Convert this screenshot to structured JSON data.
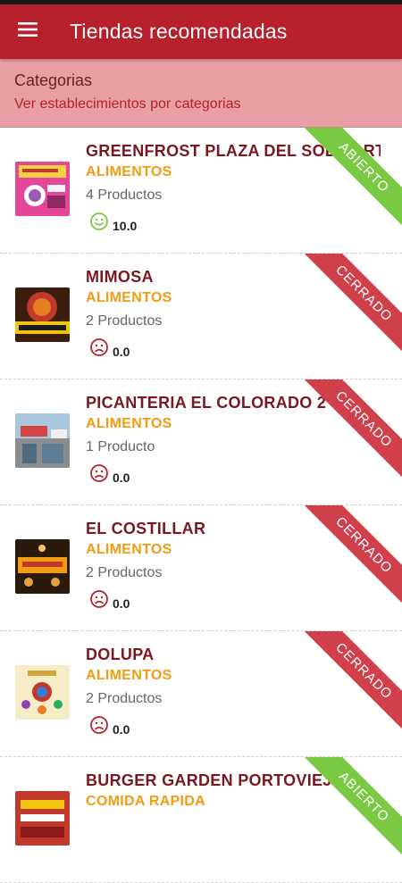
{
  "app": {
    "title": "Tiendas recomendadas",
    "menu_icon": "hamburger-menu-icon"
  },
  "categories": {
    "title": "Categorias",
    "link": "Ver establecimientos por categorias"
  },
  "stores": [
    {
      "name": "GREENFROST PLAZA DEL SOL PORTOVI",
      "category": "ALIMENTOS",
      "products": "4 Productos",
      "rating": "10.0",
      "rating_icon": "happy-face-icon",
      "status": "ABIERTO"
    },
    {
      "name": "MIMOSA",
      "category": "ALIMENTOS",
      "products": "2 Productos",
      "rating": "0.0",
      "rating_icon": "sad-face-icon",
      "status": "CERRADO"
    },
    {
      "name": "PICANTERIA EL COLORADO 2",
      "category": "ALIMENTOS",
      "products": "1 Producto",
      "rating": "0.0",
      "rating_icon": "sad-face-icon",
      "status": "CERRADO"
    },
    {
      "name": "EL COSTILLAR",
      "category": "ALIMENTOS",
      "products": "2 Productos",
      "rating": "0.0",
      "rating_icon": "sad-face-icon",
      "status": "CERRADO"
    },
    {
      "name": "DOLUPA",
      "category": "ALIMENTOS",
      "products": "2 Productos",
      "rating": "0.0",
      "rating_icon": "sad-face-icon",
      "status": "CERRADO"
    },
    {
      "name": "BURGER GARDEN PORTOVIEJO",
      "category": "COMIDA RAPIDA",
      "products": "",
      "rating": "",
      "rating_icon": "",
      "status": "ABIERTO"
    }
  ],
  "colors": {
    "primary": "#b8202b",
    "category_banner": "#e9a0a4",
    "category_text": "#f39c12",
    "open": "#7ac943",
    "closed": "#d0404a",
    "happy_icon": "#7ac943",
    "sad_icon": "#b8202b"
  }
}
